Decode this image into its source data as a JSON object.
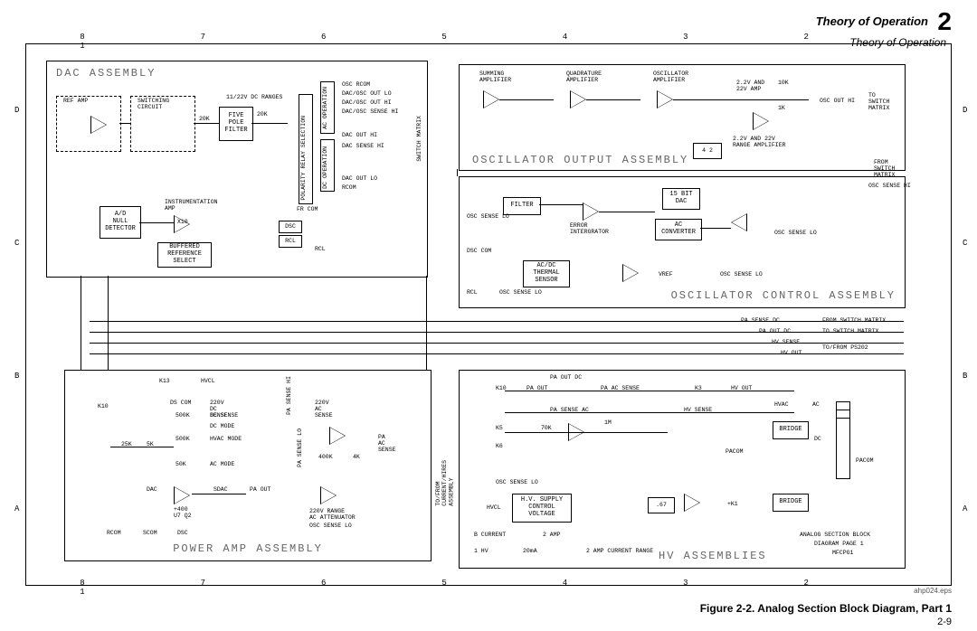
{
  "header": {
    "title1": "Theory of Operation",
    "title2": "Theory of Operation",
    "chapter": "2"
  },
  "figure": {
    "caption": "Figure 2-2. Analog Section Block Diagram, Part 1",
    "page_number": "2-9",
    "eps_name": "ahp024.eps"
  },
  "grid": {
    "columns": [
      "8",
      "7",
      "6",
      "5",
      "4",
      "3",
      "2",
      "1"
    ],
    "rows": [
      "D",
      "C",
      "B",
      "A"
    ]
  },
  "assemblies": {
    "dac": {
      "title": "DAC ASSEMBLY"
    },
    "oscout": {
      "title": "OSCILLATOR OUTPUT ASSEMBLY"
    },
    "oscctrl": {
      "title": "OSCILLATOR CONTROL ASSEMBLY"
    },
    "pa": {
      "title": "POWER AMP ASSEMBLY"
    },
    "hv": {
      "title": "HV ASSEMBLIES"
    }
  },
  "dac": {
    "ref_amp": "REF AMP",
    "switching_circuit": "SWITCHING\nCIRCUIT",
    "five_pole_filter": "FIVE\nPOLE\nFILTER",
    "r20k_a": "20K",
    "r20k_b": "20K",
    "dc_ranges": "11/22V DC RANGES",
    "polarity": "POLARITY\nRELAY SELECTION",
    "ac_op": "AC OPERATION",
    "dc_op": "DC OPERATION",
    "nets": {
      "osc_rcom": "OSC RCOM",
      "dac_osc_out_lo": "DAC/OSC OUT LO",
      "dac_osc_out_hi": "DAC/OSC OUT HI",
      "dac_osc_sense_hi": "DAC/OSC SENSE HI",
      "dac_out_hi": "DAC OUT HI",
      "dac_sense_hi": "DAC SENSE HI",
      "dac_out_lo": "DAC OUT LO",
      "rcom": "RCOM",
      "fr_com": "FR COM",
      "switch_matrix": "SWITCH MATRIX"
    },
    "null_det": "A/D\nNULL\nDETECTOR",
    "inst_amp": "INSTRUMENTATION\nAMP",
    "x10": "X10",
    "buf_ref": "BUFFERED\nREFERENCE\nSELECT",
    "ports": {
      "dsc": "DSC",
      "rcl": "RCL",
      "rcl2": "RCL"
    }
  },
  "oscout": {
    "sum_amp": "SUMMING\nAMPLIFIER",
    "quad_amp": "QUADRATURE\nAMPLIFIER",
    "osc_amp": "OSCILLATOR\nAMPLIFIER",
    "range1": "2.2V AND\n22V AMP",
    "r10k": "10K",
    "r1k": "1K",
    "range2": "2.2V AND 22V\nRANGE AMPLIFIER",
    "out_hi": "OSC OUT HI",
    "to_sw": "TO\nSWITCH\nMATRIX",
    "mux": "4 2"
  },
  "oscctrl": {
    "filter": "FILTER",
    "err_int": "ERROR\nINTERGRATOR",
    "dac15": "15 BIT\nDAC",
    "ac_conv": "AC\nCONVERTER",
    "therm": "AC/DC\nTHERMAL\nSENSOR",
    "vref": "VREF",
    "nets": {
      "osc_sense_hi": "OSC SENSE HI",
      "osc_sense_lo": "OSC SENSE LO",
      "dsc_com": "DSC COM",
      "from_sw": "FROM\nSWITCH\nMATRIX"
    }
  },
  "pa": {
    "k13": "K13",
    "k10": "K10",
    "hvcl": "HVCL",
    "r25k": "25K",
    "r5k": "5K",
    "r500k_a": "500K",
    "r500k_b": "500K",
    "r50k": "50K",
    "ds_com": "DS COM",
    "dc_sense": "DC SENSE",
    "dc_mode": "DC MODE",
    "hvac_mode": "HVAC MODE",
    "ac_mode": "AC MODE",
    "dacin": "DAC",
    "u7q2": "+400\nU7 Q2",
    "sdac": "SDAC",
    "pa_out": "PA OUT",
    "pa_sense_hi": "PA SENSE HI",
    "pa_sense_lo": "PA SENSE LO",
    "r220v_a": "220V\nDC\nSENSE",
    "r220v_b": "220V\nAC\nSENSE",
    "r400k": "400K",
    "r4k": "4K",
    "pa_ac_sense": "PA\nAC\nSENSE",
    "atten": "220V RANGE\nAC ATTENUATOR",
    "osc_sense_lo": "OSC SENSE LO",
    "rcom": "RCOM",
    "scom": "SCOM",
    "dsc": "DSC",
    "side": "TO/FROM\nCURRENT/HIRES\nASSEMBLY"
  },
  "hv": {
    "k10": "K10",
    "k3": "K3",
    "k5": "K5",
    "k6": "K6",
    "r70k": "70K",
    "r1m": "1M",
    "hv_out": "HV OUT",
    "hv_sense": "HV SENSE",
    "hvac": "HVAC",
    "ac": "AC",
    "dc": "DC",
    "bridge": "BRIDGE",
    "pacom": "PACOM",
    "pa_out": "PA OUT",
    "pa_out_dc": "PA OUT DC",
    "pa_ac_sense": "PA AC SENSE",
    "pa_sense_ac": "PA SENSE AC",
    "hvsupply": "H.V. SUPPLY\nCONTROL\nVOLTAGE",
    "hvcl": "HVCL",
    "b_current": "B CURRENT",
    "two_amp": "2 AMP",
    "one_hv": "1 HV",
    "twenty_ma": "20mA",
    "two_amp_range": "2 AMP CURRENT RANGE",
    "r67": ".67",
    "k1": "+K1",
    "osc_sense_lo": "OSC SENSE LO",
    "title_note_1": "ANALOG SECTION BLOCK",
    "title_note_2": "DIAGRAM PAGE 1",
    "title_note_3": "MFCPG1"
  },
  "bus": {
    "pa_sense_dc": "PA SENSE DC",
    "from_sw": "FROM SWITCH MATRIX",
    "pa_out_dc": "PA OUT DC",
    "to_sw": "TO SWITCH MATRIX",
    "hv_sense": "HV SENSE",
    "hv_out": "HV OUT",
    "tofrom": "TO/FROM PS202"
  }
}
